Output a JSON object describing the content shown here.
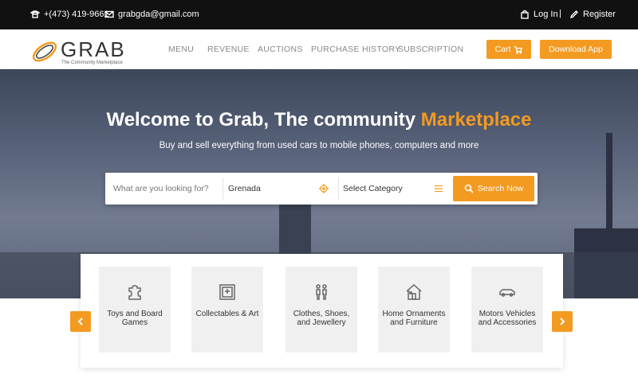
{
  "topbar": {
    "phone": "(473) 419-9661",
    "phone_display": "+(473) 419-9661",
    "email": "grabgda@gmail.com",
    "login_label": "Log In",
    "separator": "|",
    "register_label": "Register"
  },
  "brand": {
    "name": "GRAB",
    "tagline": "The Community Marketplace",
    "accent_color": "#f39a21"
  },
  "nav": {
    "items": [
      "MENU",
      "REVENUE",
      "AUCTIONS",
      "PURCHASE HISTORY",
      "SUBSCRIPTION"
    ],
    "cart_label": "Cart",
    "download_label": "Download App"
  },
  "hero": {
    "title_main": "Welcome to Grab, The community ",
    "title_accent": "Marketplace",
    "subtitle": "Buy and sell everything from used cars to mobile phones, computers and more"
  },
  "search": {
    "placeholder": "What are you looking for?",
    "location_value": "Grenada",
    "category_value": "Select Category",
    "button_label": "Search Now"
  },
  "categories": [
    {
      "label": "Toys and Board Games",
      "icon": "puzzle-icon"
    },
    {
      "label": "Collectables & Art",
      "icon": "frame-icon"
    },
    {
      "label": "Clothes, Shoes, and Jewellery",
      "icon": "people-icon"
    },
    {
      "label": "Home Ornaments and Furniture",
      "icon": "house-icon"
    },
    {
      "label": "Motors Vehicles and Accessories",
      "icon": "car-icon"
    }
  ]
}
